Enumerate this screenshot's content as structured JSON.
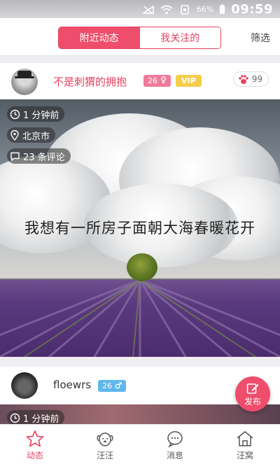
{
  "status": {
    "battery": "66%",
    "time": "09:59"
  },
  "header": {
    "tabs": [
      {
        "label": "附近动态",
        "active": true
      },
      {
        "label": "我关注的",
        "active": false
      }
    ],
    "filter_label": "筛选"
  },
  "posts": [
    {
      "username": "不是刺猬的拥抱",
      "age": "26",
      "gender": "female",
      "vip": "VIP",
      "likes": "99",
      "time": "1 分钟前",
      "location": "北京市",
      "comments": "23 条评论",
      "quote": "我想有一所房子面朝大海春暖花开"
    },
    {
      "username": "floewrs",
      "age": "26",
      "gender": "male",
      "time": "1 分钟前"
    }
  ],
  "publish_label": "发布",
  "nav": [
    {
      "label": "动态",
      "icon": "star-icon",
      "active": true
    },
    {
      "label": "汪汪",
      "icon": "dog-icon",
      "active": false
    },
    {
      "label": "消息",
      "icon": "message-icon",
      "active": false
    },
    {
      "label": "汪窝",
      "icon": "home-icon",
      "active": false
    }
  ],
  "colors": {
    "accent": "#ee4d6b",
    "vip": "#f6cc4a",
    "male": "#5fb7ee",
    "female": "#f07a9a"
  }
}
